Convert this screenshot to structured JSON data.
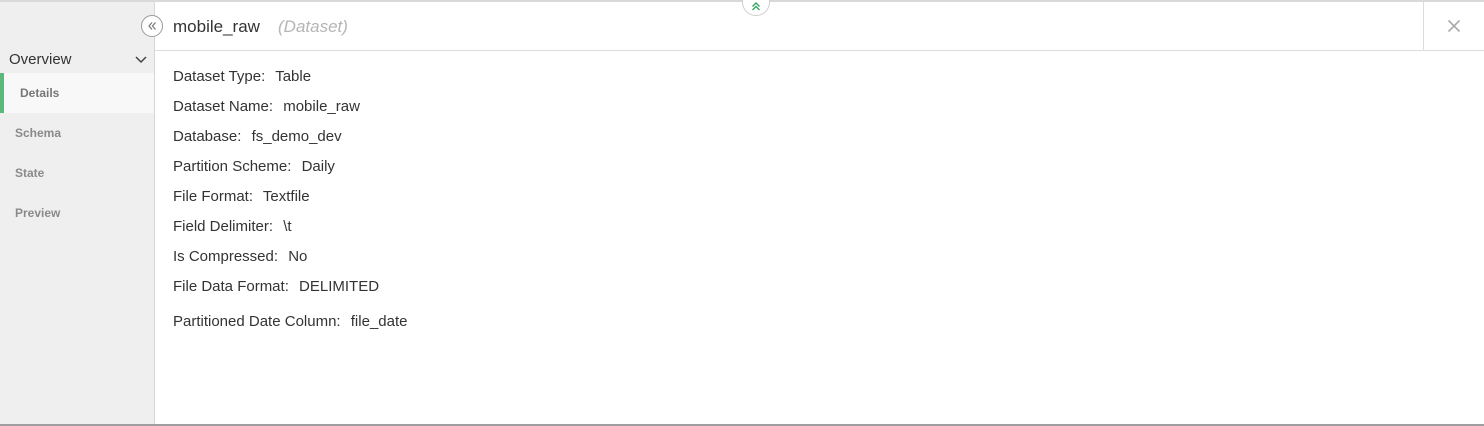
{
  "sidebar": {
    "heading": "Overview",
    "items": [
      {
        "label": "Details"
      },
      {
        "label": "Schema"
      },
      {
        "label": "State"
      },
      {
        "label": "Preview"
      }
    ],
    "active_index": 0
  },
  "header": {
    "title": "mobile_raw",
    "subtitle": "(Dataset)"
  },
  "icons": {
    "collapse": "double-chevron-left-icon",
    "close": "close-icon",
    "expand_top": "double-chevron-up-icon",
    "overview_toggle": "chevron-down-icon"
  },
  "colors": {
    "accent": "#5cb87c",
    "sidebar_bg": "#efeff0"
  },
  "details": [
    {
      "key": "Dataset Type:",
      "value": "Table"
    },
    {
      "key": "Dataset Name:",
      "value": "mobile_raw"
    },
    {
      "key": "Database:",
      "value": "fs_demo_dev"
    },
    {
      "key": "Partition Scheme:",
      "value": "Daily"
    },
    {
      "key": "File Format:",
      "value": "Textfile"
    },
    {
      "key": "Field Delimiter:",
      "value": "\\t"
    },
    {
      "key": "Is Compressed:",
      "value": "No"
    },
    {
      "key": "File Data Format:",
      "value": "DELIMITED"
    },
    {
      "key": "Partitioned Date Column:",
      "value": "file_date"
    }
  ]
}
